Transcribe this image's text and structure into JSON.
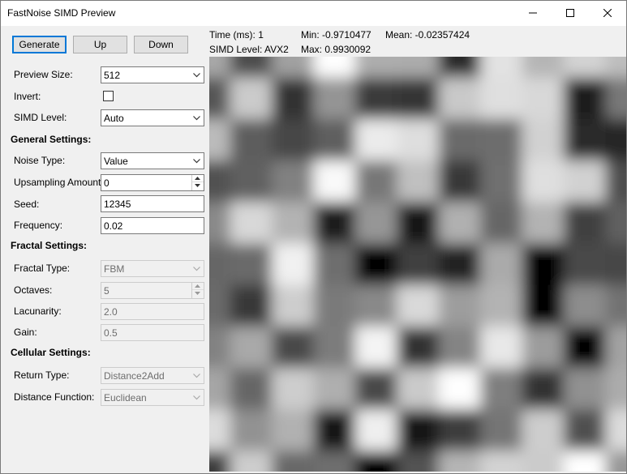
{
  "window": {
    "title": "FastNoise SIMD Preview"
  },
  "toolbar": {
    "generate_label": "Generate",
    "up_label": "Up",
    "down_label": "Down"
  },
  "settings": {
    "preview_size": {
      "label": "Preview Size:",
      "value": "512"
    },
    "invert": {
      "label": "Invert:",
      "checked": false
    },
    "simd_level": {
      "label": "SIMD Level:",
      "value": "Auto"
    }
  },
  "general": {
    "heading": "General Settings:",
    "noise_type": {
      "label": "Noise Type:",
      "value": "Value"
    },
    "upsampling": {
      "label": "Upsampling Amount:",
      "value": "0"
    },
    "seed": {
      "label": "Seed:",
      "value": "12345"
    },
    "frequency": {
      "label": "Frequency:",
      "value": "0.02"
    }
  },
  "fractal": {
    "heading": "Fractal Settings:",
    "type": {
      "label": "Fractal Type:",
      "value": "FBM"
    },
    "octaves": {
      "label": "Octaves:",
      "value": "5"
    },
    "lacunarity": {
      "label": "Lacunarity:",
      "value": "2.0"
    },
    "gain": {
      "label": "Gain:",
      "value": "0.5"
    }
  },
  "cellular": {
    "heading": "Cellular Settings:",
    "return_type": {
      "label": "Return Type:",
      "value": "Distance2Add"
    },
    "distance_function": {
      "label": "Distance Function:",
      "value": "Euclidean"
    }
  },
  "stats": {
    "time": "Time (ms): 1",
    "min": "Min:  -0.9710477",
    "mean": "Mean: -0.02357424",
    "simd": "SIMD Level: AVX2",
    "max": "Max: 0.9930092"
  },
  "colors": {
    "accent": "#0078d7",
    "window_bg": "#f0f0f0",
    "titlebar_bg": "#ffffff"
  },
  "icons": {
    "minimize": "minimize-icon",
    "maximize": "maximize-icon",
    "close": "close-icon",
    "dropdown": "chevron-down-icon",
    "spin_up": "spin-up-icon",
    "spin_down": "spin-down-icon"
  }
}
